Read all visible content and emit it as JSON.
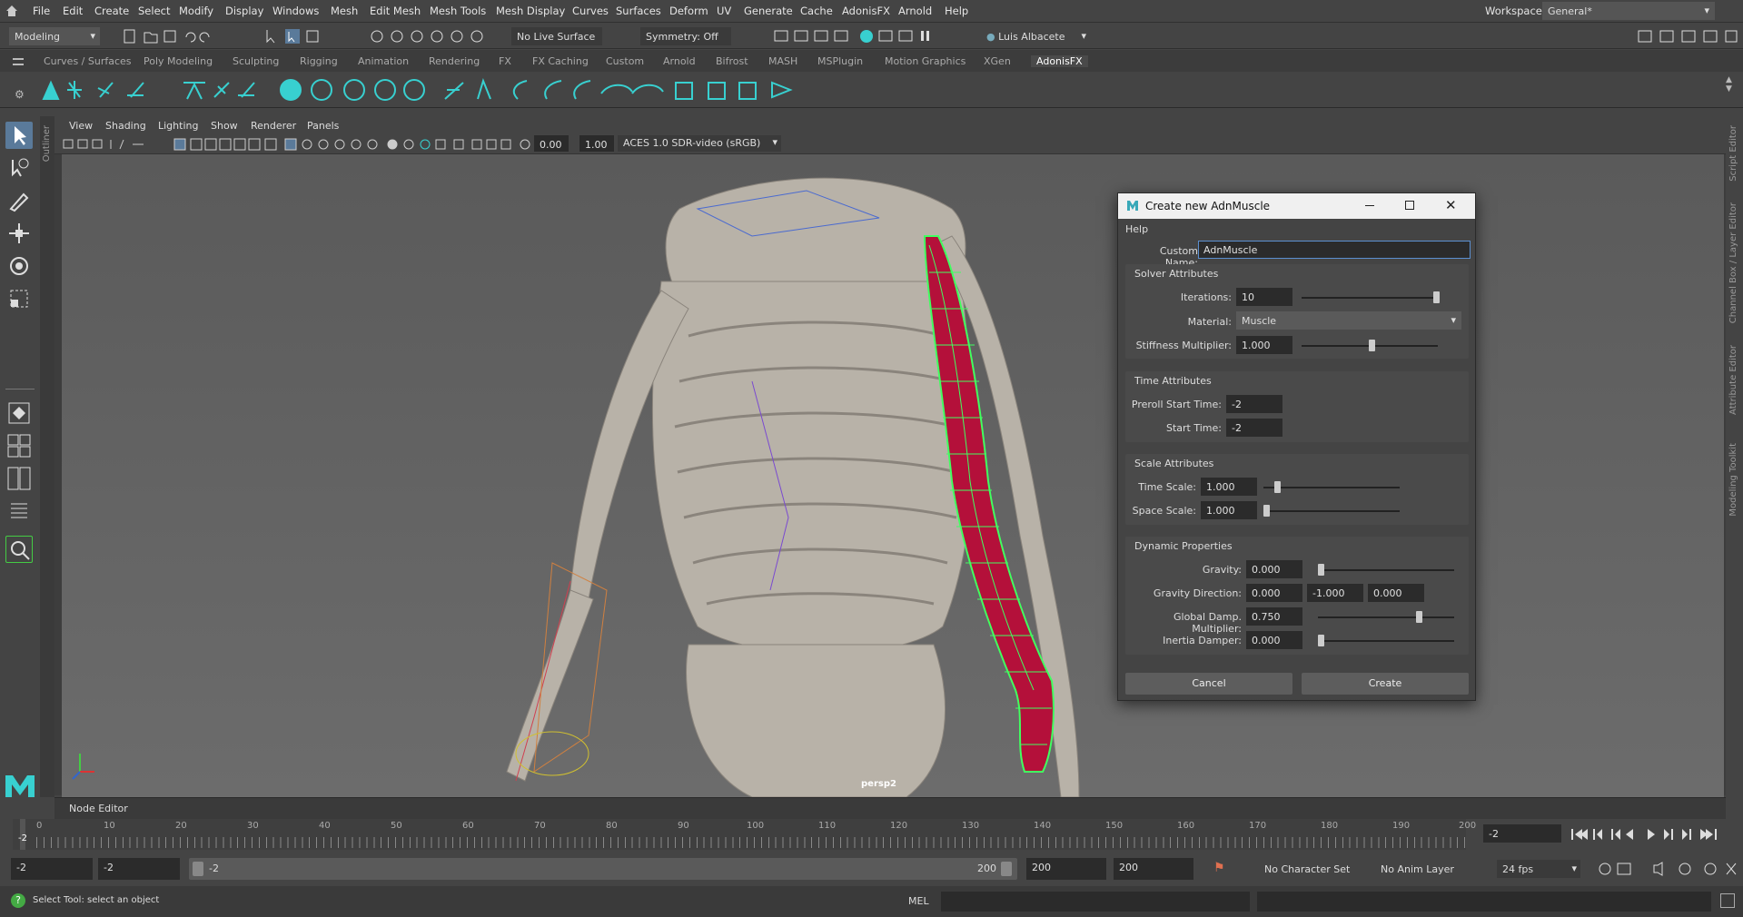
{
  "menu": [
    "File",
    "Edit",
    "Create",
    "Select",
    "Modify",
    "Display",
    "Windows",
    "Mesh",
    "Edit Mesh",
    "Mesh Tools",
    "Mesh Display",
    "Curves",
    "Surfaces",
    "Deform",
    "UV",
    "Generate",
    "Cache",
    "AdonisFX",
    "Arnold",
    "Help"
  ],
  "workspace": {
    "label": "Workspace:",
    "value": "General*"
  },
  "status": {
    "mode": "Modeling",
    "live_surface": "No Live Surface",
    "symmetry": "Symmetry: Off",
    "user": "Luis Albacete"
  },
  "shelf_tabs": [
    "Curves / Surfaces",
    "Poly Modeling",
    "Sculpting",
    "Rigging",
    "Animation",
    "Rendering",
    "FX",
    "FX Caching",
    "Custom",
    "Arnold",
    "Bifrost",
    "MASH",
    "MSPlugin",
    "Motion Graphics",
    "XGen",
    "AdonisFX"
  ],
  "shelf_active": "AdonisFX",
  "panel_menu": [
    "View",
    "Shading",
    "Lighting",
    "Show",
    "Renderer",
    "Panels"
  ],
  "viewport": {
    "field1": "0.00",
    "field2": "1.00",
    "color_space": "ACES 1.0 SDR-video (sRGB)",
    "camera": "persp2"
  },
  "side_labels": {
    "outliner": "Outliner",
    "right": [
      "Script Editor",
      "Channel Box / Layer Editor",
      "Attribute Editor",
      "Modeling Toolkit"
    ]
  },
  "node_editor": "Node Editor",
  "timeline": {
    "ticks": [
      "0",
      "10",
      "20",
      "30",
      "40",
      "50",
      "60",
      "70",
      "80",
      "90",
      "100",
      "110",
      "120",
      "130",
      "140",
      "150",
      "160",
      "170",
      "180",
      "190",
      "200"
    ],
    "current": "-2",
    "current_field": "-2"
  },
  "range": {
    "start": "-2",
    "start2": "-2",
    "slider_start": "-2",
    "slider_end": "200",
    "end": "200",
    "end2": "200",
    "char_set": "No Character Set",
    "anim_layer": "No Anim Layer",
    "fps": "24 fps"
  },
  "help_line": "Select Tool: select an object",
  "mel": "MEL",
  "dialog": {
    "title": "Create new AdnMuscle",
    "menu_help": "Help",
    "custom_name_label": "Custom Name:",
    "custom_name": "AdnMuscle",
    "solver": {
      "title": "Solver Attributes",
      "iterations_label": "Iterations:",
      "iterations": "10",
      "material_label": "Material:",
      "material": "Muscle",
      "stiffness_label": "Stiffness Multiplier:",
      "stiffness": "1.000"
    },
    "time": {
      "title": "Time Attributes",
      "preroll_label": "Preroll Start Time:",
      "preroll": "-2",
      "start_label": "Start Time:",
      "start": "-2"
    },
    "scale": {
      "title": "Scale Attributes",
      "time_label": "Time Scale:",
      "time": "1.000",
      "space_label": "Space Scale:",
      "space": "1.000"
    },
    "dynamic": {
      "title": "Dynamic Properties",
      "gravity_label": "Gravity:",
      "gravity": "0.000",
      "gdir_label": "Gravity Direction:",
      "gdir_x": "0.000",
      "gdir_y": "-1.000",
      "gdir_z": "0.000",
      "damp_label": "Global Damp. Multiplier:",
      "damp": "0.750",
      "inertia_label": "Inertia Damper:",
      "inertia": "0.000"
    },
    "cancel": "Cancel",
    "create": "Create"
  },
  "colors": {
    "accent": "#38d0d0",
    "muscle": "#b4103a",
    "wire": "#40ff60"
  }
}
